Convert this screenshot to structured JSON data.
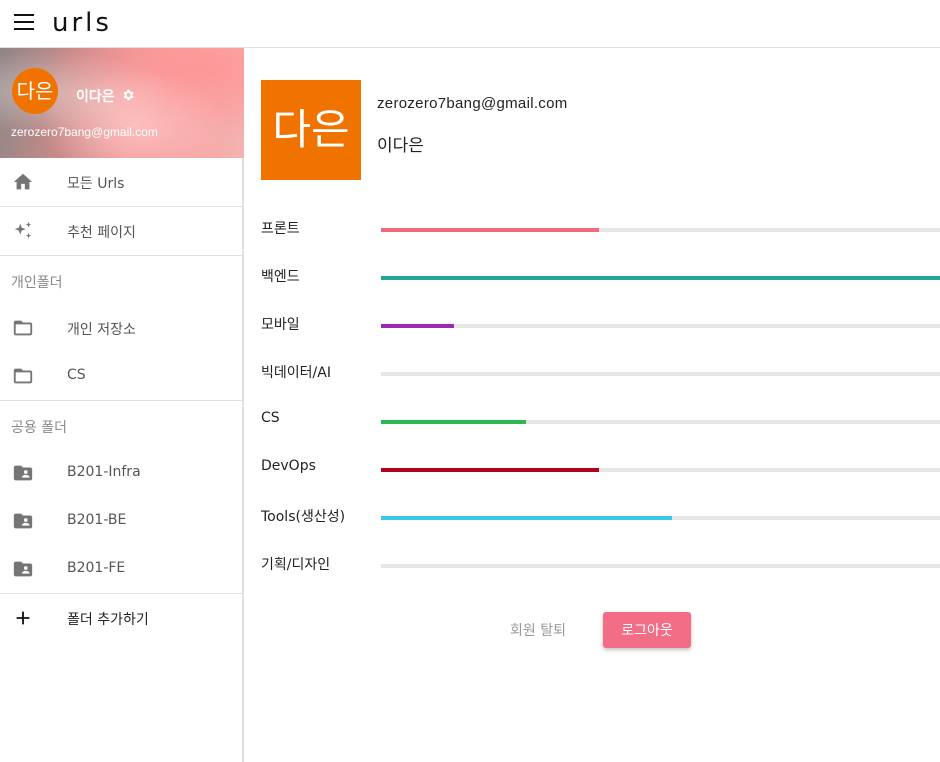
{
  "app": {
    "logo": "urls"
  },
  "icons": {
    "menu": "menu-icon",
    "gear": "gear-icon",
    "home": "home-icon",
    "sparkle": "sparkle-icon",
    "folder": "folder-icon",
    "shared_folder": "shared-folder-icon",
    "plus": "plus-icon"
  },
  "sidebar": {
    "profile": {
      "avatar_text": "다은",
      "name": "이다은",
      "email": "zerozero7bang@gmail.com"
    },
    "nav": [
      {
        "label": "모든 Urls",
        "icon": "home-icon"
      },
      {
        "label": "추천 페이지",
        "icon": "sparkle-icon"
      }
    ],
    "personal_section": "개인폴더",
    "personal_folders": [
      {
        "label": "개인 저장소",
        "icon": "folder-icon"
      },
      {
        "label": "CS",
        "icon": "folder-icon"
      }
    ],
    "shared_section": "공용 폴더",
    "shared_folders": [
      {
        "label": "B201-Infra",
        "icon": "shared-folder-icon"
      },
      {
        "label": "B201-BE",
        "icon": "shared-folder-icon"
      },
      {
        "label": "B201-FE",
        "icon": "shared-folder-icon"
      }
    ],
    "add_folder": "폴더 추가하기"
  },
  "main": {
    "avatar_text": "다은",
    "email": "zerozero7bang@gmail.com",
    "name": "이다은",
    "skills": [
      {
        "label": "프론트",
        "value": 0.39,
        "color": "#f06a7c"
      },
      {
        "label": "백엔드",
        "value": 1.0,
        "color": "#26a69a"
      },
      {
        "label": "모바일",
        "value": 0.13,
        "color": "#9c27b0"
      },
      {
        "label": "빅데이터/AI",
        "value": 0.0,
        "color": "#9e9e9e"
      },
      {
        "label": "CS",
        "value": 0.26,
        "color": "#2db84d"
      },
      {
        "label": "DevOps",
        "value": 0.39,
        "color": "#b3001b"
      },
      {
        "label": "Tools(생산성)",
        "value": 0.52,
        "color": "#3cc8e6"
      },
      {
        "label": "기획/디자인",
        "value": 0.0,
        "color": "#9e9e9e"
      }
    ],
    "withdraw": "회원 탈퇴",
    "logout": "로그아웃"
  },
  "colors": {
    "avatar": "#f07300",
    "logout": "#f36d86"
  }
}
